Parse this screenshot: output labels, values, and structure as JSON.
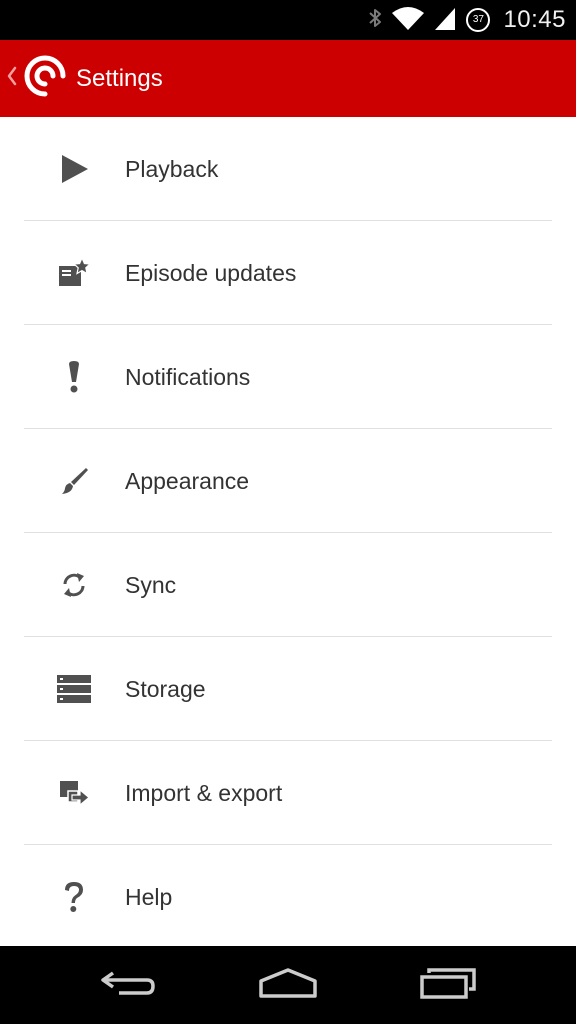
{
  "status_bar": {
    "time": "10:45",
    "battery_level": "37",
    "icons": [
      "bluetooth-icon",
      "wifi-icon",
      "signal-icon",
      "battery-icon"
    ]
  },
  "action_bar": {
    "title": "Settings",
    "color": "#cc0000",
    "icons": [
      "back-chevron-icon",
      "app-logo-icon"
    ]
  },
  "settings": {
    "items": [
      {
        "label": "Playback",
        "icon": "play-icon"
      },
      {
        "label": "Episode updates",
        "icon": "episode-updates-icon"
      },
      {
        "label": "Notifications",
        "icon": "exclamation-icon"
      },
      {
        "label": "Appearance",
        "icon": "paintbrush-icon"
      },
      {
        "label": "Sync",
        "icon": "sync-icon"
      },
      {
        "label": "Storage",
        "icon": "storage-icon"
      },
      {
        "label": "Import & export",
        "icon": "import-export-icon"
      },
      {
        "label": "Help",
        "icon": "help-icon"
      }
    ]
  },
  "nav_bar": {
    "icons": [
      "back-icon",
      "home-icon",
      "recents-icon"
    ]
  }
}
